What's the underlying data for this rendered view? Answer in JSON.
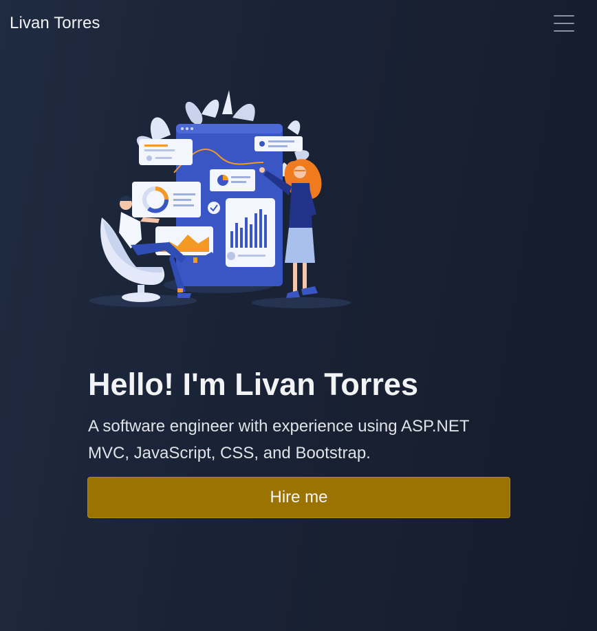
{
  "navbar": {
    "brand": "Livan Torres",
    "toggler_icon": "hamburger-menu-icon"
  },
  "hero": {
    "illustration": "analytics-dashboard-illustration",
    "title": "Hello! I'm Livan Torres",
    "subtitle": "A software engineer with experience using ASP.NET MVC, JavaScript, CSS, and Bootstrap.",
    "cta_label": "Hire me"
  },
  "colors": {
    "background": "#1c263a",
    "button": "#9a7300",
    "accent_blue": "#3a55c4",
    "accent_orange": "#f39a24"
  }
}
